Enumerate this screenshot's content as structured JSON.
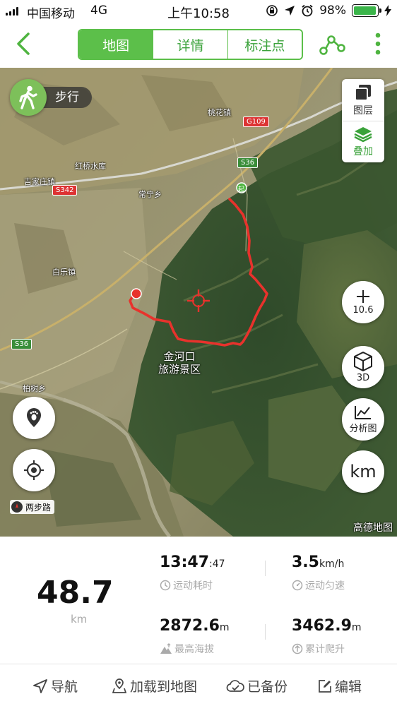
{
  "status_bar": {
    "carrier": "中国移动",
    "network": "4G",
    "time": "上午10:58",
    "battery_percent": "98%",
    "battery_level": 0.98
  },
  "nav": {
    "tabs": [
      "地图",
      "详情",
      "标注点"
    ],
    "active_tab": 0
  },
  "map": {
    "mode_label": "步行",
    "layers_label": "图层",
    "overlay_label": "叠加",
    "zoom_value": "10.6",
    "view_3d_label": "3D",
    "analysis_label": "分析图",
    "unit_label": "km",
    "places": {
      "taohua": "桃花镇",
      "hongqiao": "红桥水库",
      "jijiazhuang": "吉家庄镇",
      "changning": "常宁乡",
      "baiyue": "白乐镇",
      "baishu": "柏树乡"
    },
    "roads": {
      "g109": "G109",
      "s36_top": "S36",
      "s342": "S342",
      "s36_left": "S36"
    },
    "scenic_area": [
      "金河口",
      "旅游景区"
    ],
    "start_marker": "起",
    "scale_label": "两步路",
    "brand": "高德地图",
    "track_color": "#e8322c"
  },
  "stats": {
    "distance": "48.7",
    "distance_unit": "km",
    "duration_main": "13:47",
    "duration_sub": ":47",
    "duration_label": "运动耗时",
    "speed_value": "3.5",
    "speed_unit": "km/h",
    "speed_label": "运动匀速",
    "max_alt_value": "2872.6",
    "max_alt_unit": "m",
    "max_alt_label": "最高海拔",
    "climb_value": "3462.9",
    "climb_unit": "m",
    "climb_label": "累计爬升"
  },
  "toolbar": {
    "navigate": "导航",
    "load_to_map": "加载到地图",
    "backed_up": "已备份",
    "edit": "编辑"
  },
  "colors": {
    "accent_green": "#5cbf4a"
  },
  "icons": [
    "signal-icon",
    "location-arrow-icon",
    "alarm-icon",
    "battery-icon",
    "back-chevron-icon",
    "route-share-icon",
    "more-vertical-icon",
    "walker-icon",
    "layers-icon",
    "overlay-stack-icon",
    "zoom-plus-icon",
    "cube-3d-icon",
    "chart-icon",
    "footprint-icon",
    "locate-icon",
    "compass-icon",
    "clock-icon",
    "speed-icon",
    "altitude-icon",
    "climb-icon",
    "navigate-arrow-icon",
    "pin-map-icon",
    "cloud-backup-icon",
    "edit-icon"
  ]
}
